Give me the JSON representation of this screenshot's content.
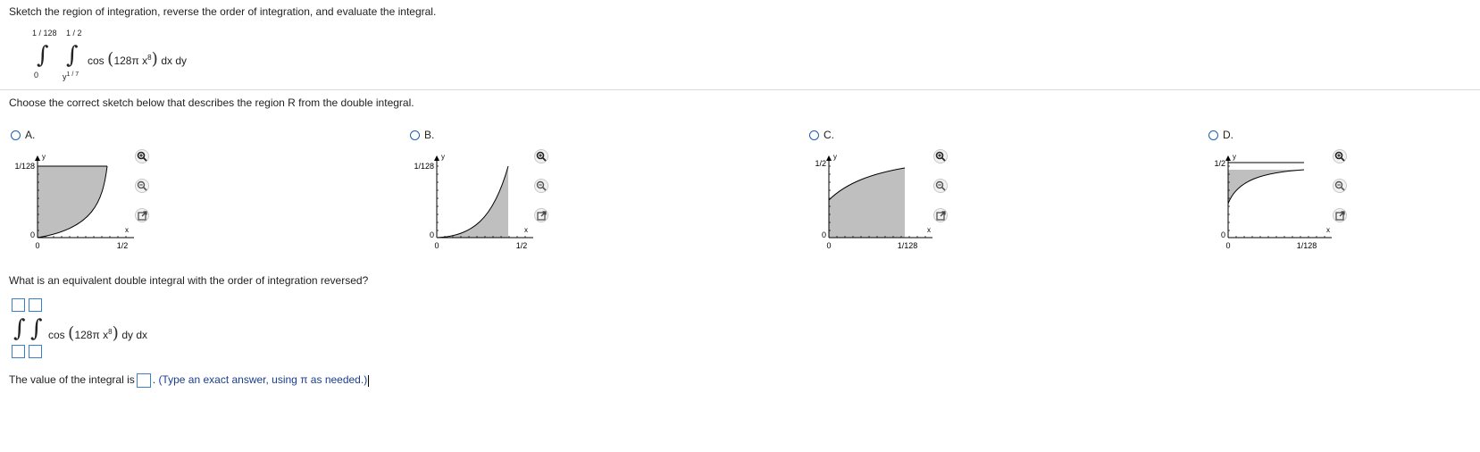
{
  "problem": {
    "instruction": "Sketch the region of integration, reverse the order of integration, and evaluate the integral.",
    "outer_upper": "1 / 128",
    "outer_lower": "0",
    "inner_upper": "1 / 2",
    "inner_lower_base": "y",
    "inner_lower_exp": "1 / 7",
    "func_name": "cos",
    "func_arg_base": "128π x",
    "func_arg_exp": "8",
    "differentials": "dx dy"
  },
  "sketch_question": "Choose the correct sketch below that describes the region R from the double integral.",
  "options": [
    {
      "letter": "A.",
      "y_label": "1/128",
      "x_label": "1/2",
      "axis_y": "y",
      "axis_x": "x",
      "origin_y": "0",
      "origin_x": "0"
    },
    {
      "letter": "B.",
      "y_label": "1/128",
      "x_label": "1/2",
      "axis_y": "y",
      "axis_x": "x",
      "origin_y": "0",
      "origin_x": "0"
    },
    {
      "letter": "C.",
      "y_label": "1/2",
      "x_label": "1/128",
      "axis_y": "y",
      "axis_x": "x",
      "origin_y": "0",
      "origin_x": "0"
    },
    {
      "letter": "D.",
      "y_label": "1/2",
      "x_label": "1/128",
      "axis_y": "y",
      "axis_x": "x",
      "origin_y": "0",
      "origin_x": "0"
    }
  ],
  "reverse": {
    "question": "What is an equivalent double integral with the order of integration reversed?",
    "func_name": "cos",
    "func_arg_base": "128π x",
    "func_arg_exp": "8",
    "differentials": "dy dx"
  },
  "value": {
    "prefix": "The value of the integral is",
    "suffix": ".",
    "hint": "(Type an exact answer, using π as needed.)"
  },
  "colors": {
    "accent": "#1c5fb0",
    "box_border": "#3a7fc8",
    "shade": "#bfbfbf",
    "hint": "#1a3d8f"
  }
}
